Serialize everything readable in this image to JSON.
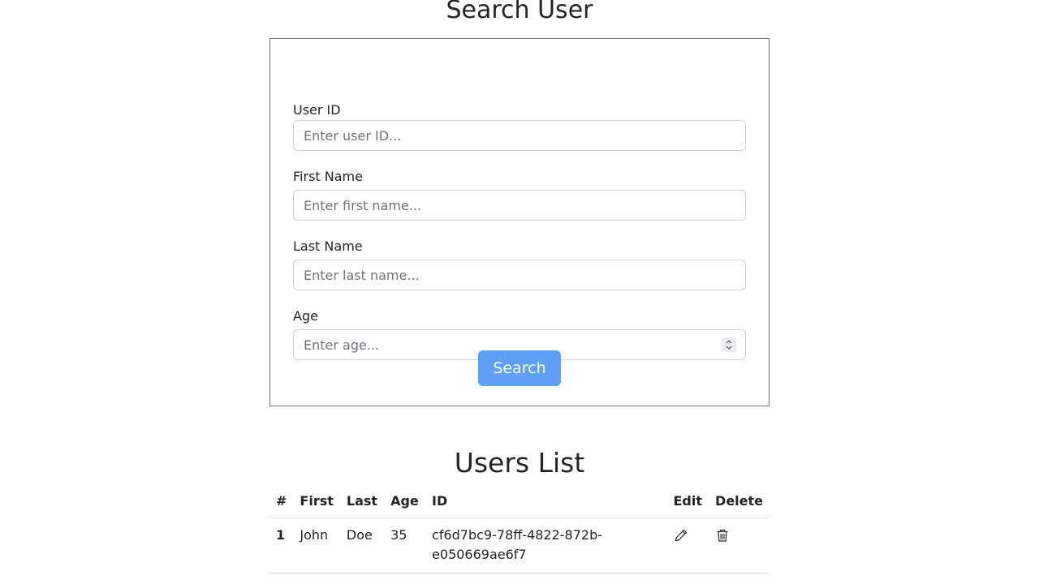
{
  "search": {
    "title": "Search User",
    "fields": {
      "user_id": {
        "label": "User ID",
        "placeholder": "Enter user ID..."
      },
      "first_name": {
        "label": "First Name",
        "placeholder": "Enter first name..."
      },
      "last_name": {
        "label": "Last Name",
        "placeholder": "Enter last name..."
      },
      "age": {
        "label": "Age",
        "placeholder": "Enter age..."
      }
    },
    "button_label": "Search",
    "button_color": "#5ea0f7"
  },
  "users": {
    "title": "Users List",
    "columns": [
      "#",
      "First",
      "Last",
      "Age",
      "ID",
      "Edit",
      "Delete"
    ],
    "rows": [
      {
        "num": "1",
        "first": "John",
        "last": "Doe",
        "age": "35",
        "id": "cf6d7bc9-78ff-4822-872b-e050669ae6f7",
        "edit_icon": "pencil-icon",
        "delete_icon": "trash-icon"
      }
    ]
  }
}
